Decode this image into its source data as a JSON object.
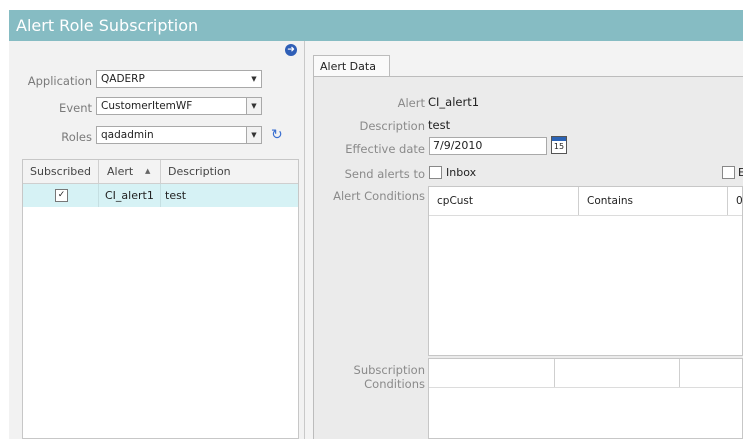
{
  "window": {
    "title": "Alert Role Subscription"
  },
  "filters": {
    "application_label": "Application",
    "application_value": "QADERP",
    "event_label": "Event",
    "event_value": "CustomerItemWF",
    "roles_label": "Roles",
    "roles_value": "qadadmin"
  },
  "grid": {
    "columns": [
      "Subscribed",
      "Alert",
      "Description"
    ],
    "sort_indicator": "▲",
    "rows": [
      {
        "subscribed": true,
        "check_glyph": "✓",
        "alert": "CI_alert1",
        "description": "test"
      }
    ]
  },
  "tab": {
    "label": "Alert Data"
  },
  "detail": {
    "alert_label": "Alert",
    "alert_value": "CI_alert1",
    "description_label": "Description",
    "description_value": "test",
    "effective_date_label": "Effective date",
    "effective_date_value": "7/9/2010",
    "calendar_day": "15",
    "send_alerts_label": "Send alerts to",
    "inbox_label": "Inbox",
    "second_channel_label": "E",
    "alert_conditions_label": "Alert Conditions",
    "alert_conditions": [
      {
        "field": "cpCust",
        "operator": "Contains",
        "value": "0"
      }
    ],
    "subscription_conditions_label_line1": "Subscription",
    "subscription_conditions_label_line2": "Conditions"
  },
  "icons": {
    "navigate": "navigate-arrow-icon",
    "refresh": "refresh-icon",
    "calendar": "calendar-icon",
    "dropdown": "chevron-down-icon"
  },
  "colors": {
    "titlebar": "#86bcc3",
    "selected_row": "#d6f2f5",
    "accent_blue": "#3a6fd0"
  }
}
